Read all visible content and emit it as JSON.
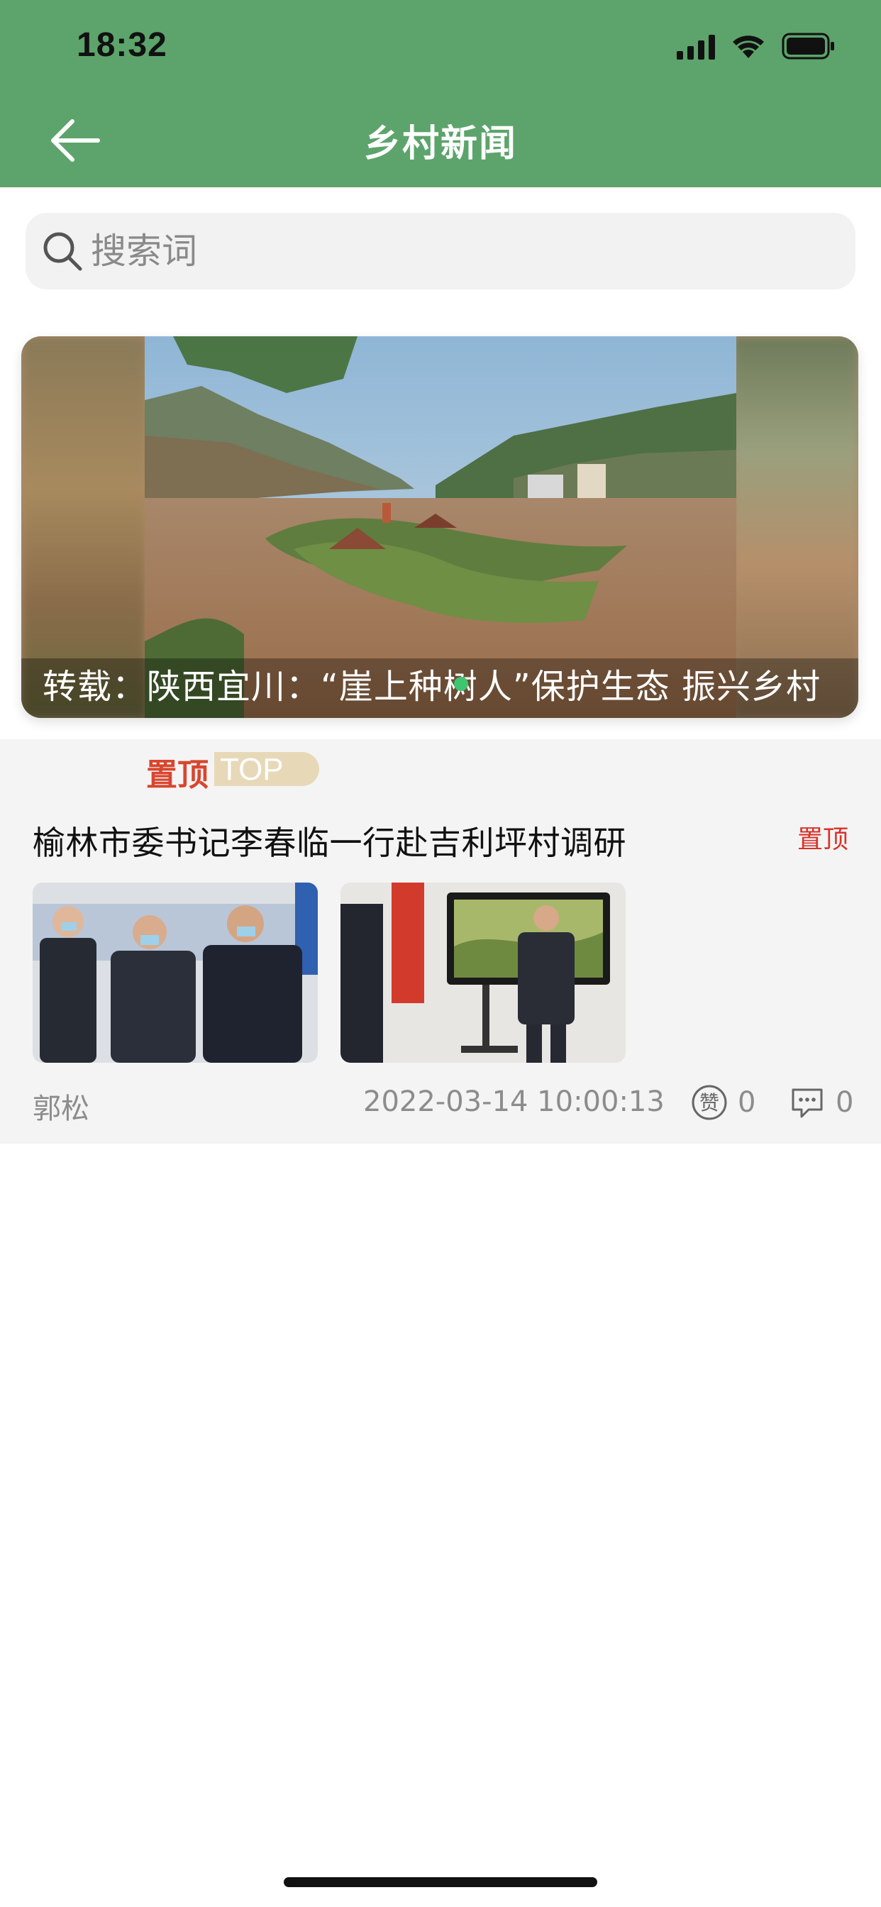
{
  "status_bar": {
    "time": "18:32"
  },
  "header": {
    "title": "乡村新闻",
    "back_icon": "arrow-left-icon"
  },
  "search": {
    "placeholder": "搜索词",
    "icon": "search-icon"
  },
  "banner": {
    "caption": "转载：陕西宜川：“崖上种树人”保护生态 振兴乡村",
    "active_dot_color": "#3fc46f"
  },
  "article": {
    "badge_zh": "置顶",
    "badge_en": "TOP",
    "title": "榆林市委书记李春临一行赴吉利坪村调研",
    "pin_label": "置顶",
    "author": "郭松",
    "date": "2022-03-14 10:00:13",
    "likes": "0",
    "comments": "0"
  },
  "colors": {
    "header_green": "#5ca46b",
    "pin_red": "#d9322a"
  }
}
